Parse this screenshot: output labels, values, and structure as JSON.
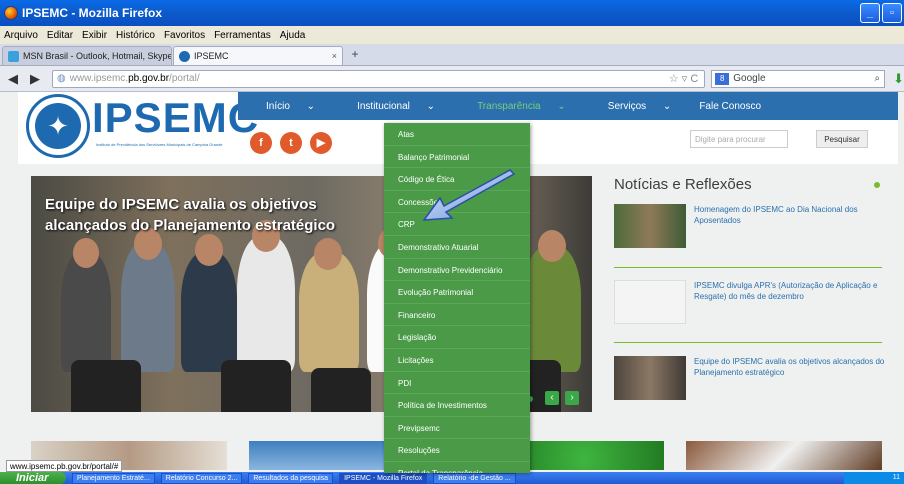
{
  "window": {
    "title": "IPSEMC - Mozilla Firefox"
  },
  "menu": [
    "Arquivo",
    "Editar",
    "Exibir",
    "Histórico",
    "Favoritos",
    "Ferramentas",
    "Ajuda"
  ],
  "tabs": [
    {
      "label": "MSN Brasil - Outlook, Hotmail, Skype, Not..."
    },
    {
      "label": "IPSEMC"
    }
  ],
  "urlbar": {
    "prefix": "www.ipsemc.",
    "domain": "pb.gov.br",
    "path": "/portal/"
  },
  "websearch": {
    "engine": "Google"
  },
  "site": {
    "logo": "IPSEMC",
    "logo_sub": "Instituto de Previdência dos Servidores Municipais de Campina Grande",
    "nav": [
      "Início",
      "Institucional",
      "Transparência",
      "Serviços",
      "Fale Conosco"
    ],
    "search_placeholder": "Digite para procurar",
    "search_button": "Pesquisar",
    "slide_title": "Equipe do IPSEMC avalia os objetivos alcançados do Planejamento estratégico",
    "dropdown": [
      "Atas",
      "Balanço Patrimonial",
      "Código de Ética",
      "Concessões",
      "CRP",
      "Demonstrativo Atuarial",
      "Demonstrativo Previdenciário",
      "Evolução Patrimonial",
      "Financeiro",
      "Legislação",
      "Licitações",
      "PDI",
      "Política de Investimentos",
      "Previpsemc",
      "Resoluções",
      "Portal da Transparência"
    ],
    "news_heading": "Notícias e Reflexões",
    "news": [
      {
        "title": "Homenagem do IPSEMC ao Dia Nacional dos Aposentados"
      },
      {
        "title": "IPSEMC divulga APR's (Autorização de Aplicação e Resgate) do mês de dezembro"
      },
      {
        "title": "Equipe do IPSEMC avalia os objetivos alcançados do Planejamento estratégico"
      }
    ]
  },
  "status_url": "www.ipsemc.pb.gov.br/portal/#",
  "taskbar": {
    "start": "Iniciar",
    "items": [
      "Planejamento Estraté...",
      "Relatório Concurso 2...",
      "Resultados da pesquisa",
      "IPSEMC - Mozilla Firefox",
      "Relatório -de Gestão ..."
    ],
    "clock": "11"
  },
  "colors": {
    "brand_blue": "#2b6fae",
    "dropdown_green": "#4a9a48",
    "accent_green": "#7bbb2b"
  }
}
